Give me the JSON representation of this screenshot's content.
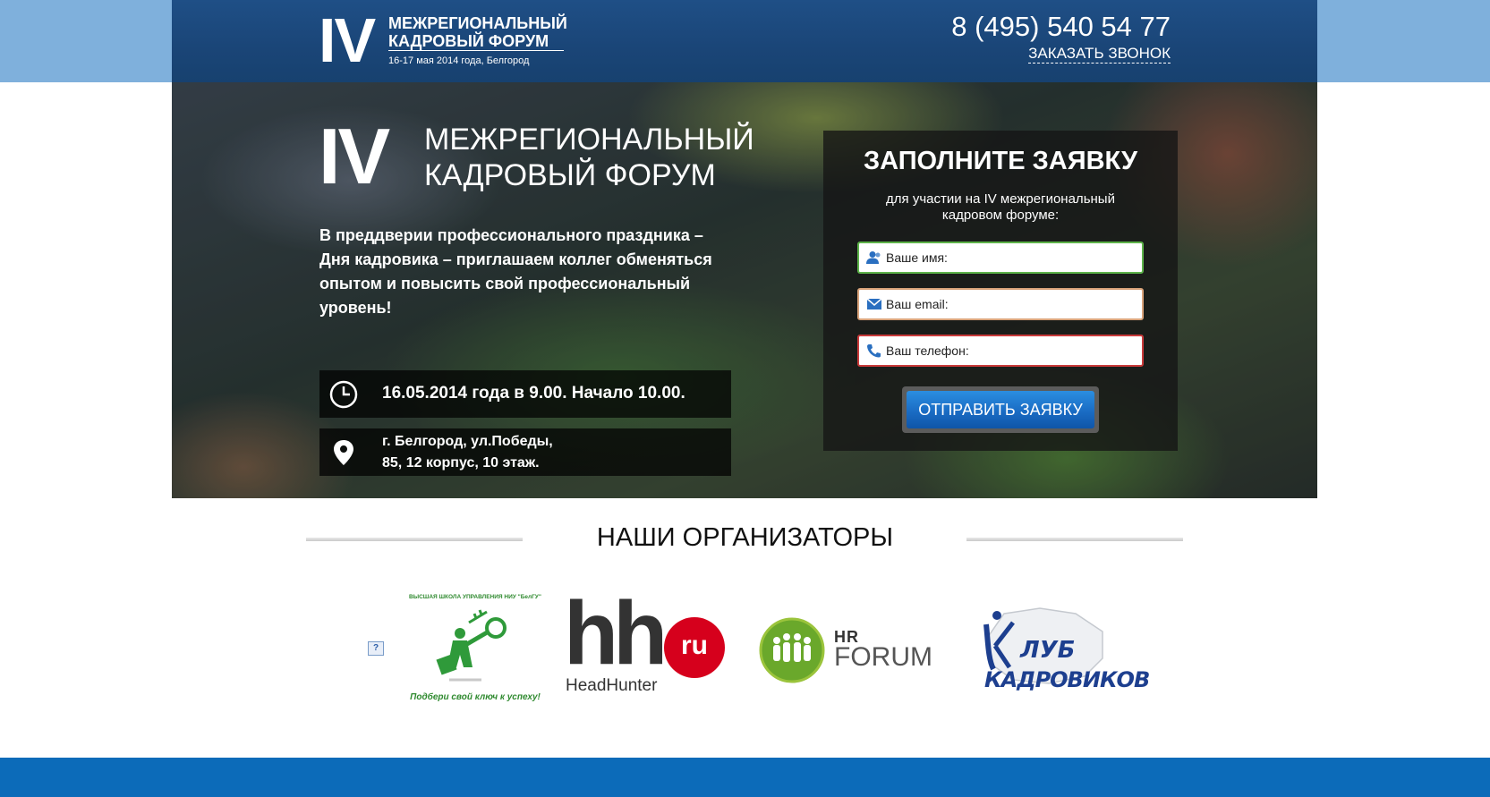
{
  "header": {
    "logo_numeral": "IV",
    "logo_line1": "МЕЖРЕГИОНАЛЬНЫЙ",
    "logo_line2": "КАДРОВЫЙ ФОРУМ",
    "logo_date": "16-17 мая 2014 года, Белгород",
    "phone": "8 (495) 540 54 77",
    "callback_label": "ЗАКАЗАТЬ ЗВОНОК"
  },
  "hero": {
    "numeral": "IV",
    "title_line1": "МЕЖРЕГИОНАЛЬНЫЙ",
    "title_line2": "КАДРОВЫЙ ФОРУМ",
    "description": "В преддверии профессионального праздника – Дня кадровика – приглашаем коллег обменяться опытом и повысить свой профессиональный уровень!",
    "date_text": "16.05.2014 года в 9.00. Начало 10.00.",
    "address_line1": "г. Белгород, ул.Победы,",
    "address_line2": "85, 12 корпус, 10 этаж.",
    "icons": {
      "date": "clock-icon",
      "address": "map-pin-icon"
    }
  },
  "form": {
    "title": "ЗАПОЛНИТЕ ЗАЯВКУ",
    "subtitle": "для участии на IV межрегиональный кадровом форуме:",
    "name_placeholder": "Ваше имя:",
    "email_placeholder": "Ваш email:",
    "phone_placeholder": "Ваш телефон:",
    "submit_label": "ОТПРАВИТЬ ЗАЯВКУ",
    "icons": {
      "name": "user-icon",
      "email": "envelope-icon",
      "phone": "phone-icon"
    }
  },
  "organizers": {
    "title": "НАШИ ОРГАНИЗАТОРЫ",
    "broken_image_glyph": "?",
    "vshu_top": "ВЫСШАЯ ШКОЛА УПРАВЛЕНИЯ НИУ \"БелГУ\"",
    "vshu_slogan": "Подбери свой ключ к успеху!",
    "hh_letters": "hh",
    "hh_ru": "ru",
    "hh_name": "HeadHunter",
    "hrforum_hr": "HR",
    "hrforum_forum": "FORUM",
    "club_lub": "ЛУБ",
    "club_kadrovikov": "КАДРОВИКОВ"
  },
  "colors": {
    "header_bg": "#1f4f86",
    "top_band": "#7fb0dc",
    "footer_band": "#0c6bb9",
    "submit_button": "#1a6cc4",
    "hh_red": "#d6001c",
    "vshu_green": "#2f8a2f"
  }
}
